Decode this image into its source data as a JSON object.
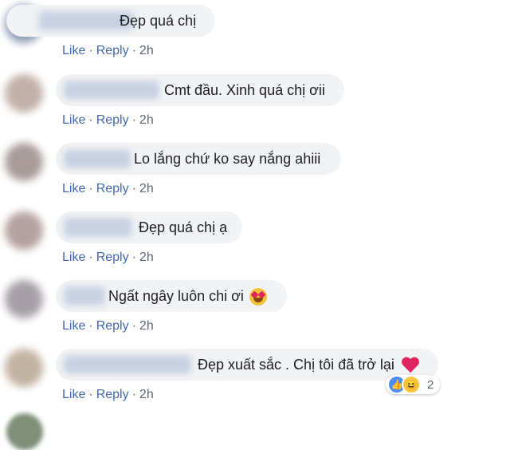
{
  "actions": {
    "like": "Like",
    "reply": "Reply",
    "separator": "·"
  },
  "comments": [
    {
      "text": "Đẹp quá chị",
      "time": "2h"
    },
    {
      "text": "Cmt đầu. Xinh quá chị ơii",
      "time": "2h"
    },
    {
      "text": "Lo lắng chứ ko say nắng ahiii",
      "time": "2h"
    },
    {
      "text": "Đẹp quá chị ạ",
      "time": "2h"
    },
    {
      "text": "Ngất ngây luôn chi ơi",
      "time": "2h",
      "emoji": "heart-eyes-icon"
    },
    {
      "text": "Đẹp xuất sắc . Chị tôi đã trở lại",
      "time": "2h",
      "emoji": "heart-icon",
      "reactions": {
        "icons": [
          "like-icon",
          "haha-icon"
        ],
        "count": "2"
      }
    }
  ],
  "colors": {
    "link": "#4267b2",
    "bubble": "#f2f3f5",
    "heart": "#e0245e"
  }
}
